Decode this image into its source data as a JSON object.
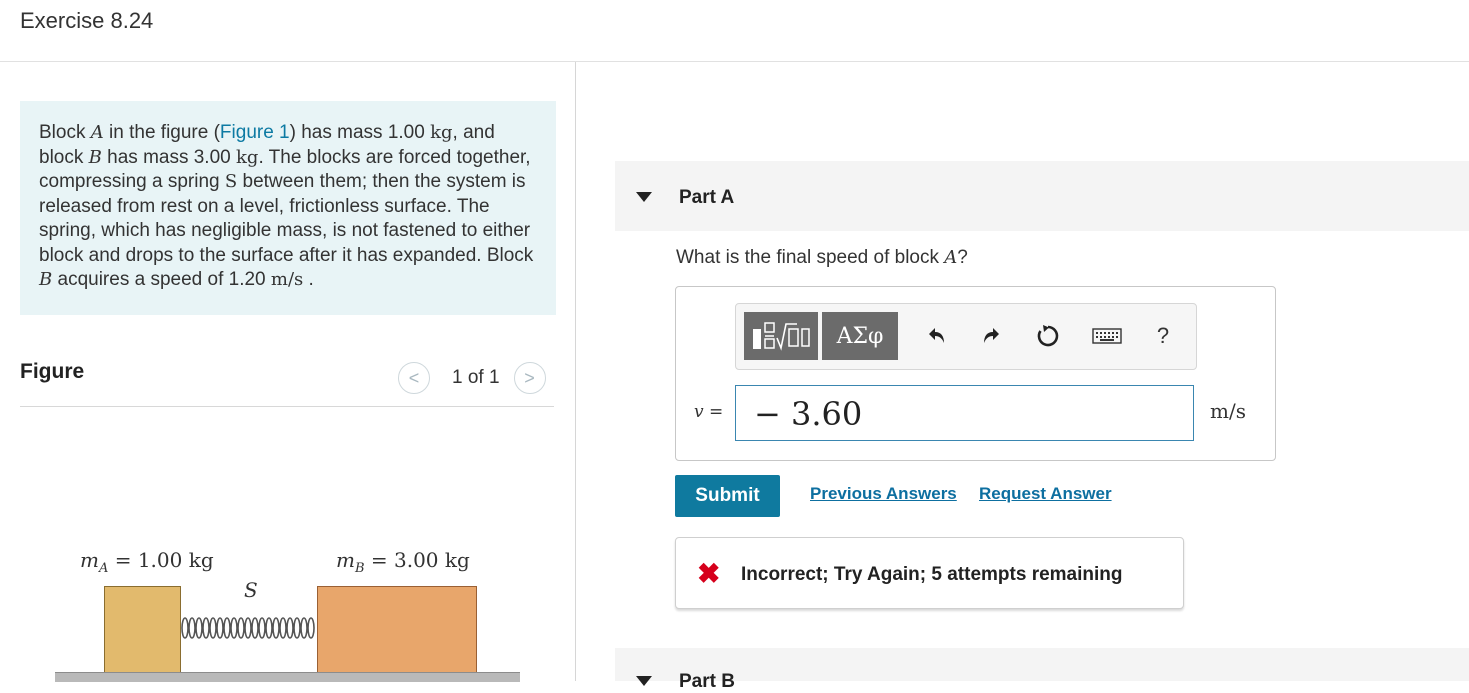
{
  "header": {
    "title": "Exercise 8.24"
  },
  "problem": {
    "seg1": "Block ",
    "blockA": "A",
    "seg2": " in the figure (",
    "figure_link": "Figure 1",
    "seg3": ") has mass 1.00 ",
    "kg1": "kg",
    "seg4": ", and block ",
    "blockB": "B",
    "seg5": " has mass 3.00 ",
    "kg2": "kg",
    "seg6": ". The blocks are forced together, compressing a spring ",
    "springS": "S",
    "seg7": " between them; then the system is released from rest on a level, frictionless surface. The spring, which has negligible mass, is not fastened to either block and drops to the surface after it has expanded. Block ",
    "blockB2": "B",
    "seg8": " acquires a speed of 1.20 ",
    "speed_unit": "m/s",
    "seg9": " ."
  },
  "figure": {
    "label": "Figure",
    "pager": "1 of 1",
    "prev_symbol": "<",
    "next_symbol": ">",
    "mass_a_sym": "m",
    "mass_a_sub": "A",
    "mass_a_val": " = 1.00 kg",
    "mass_b_sym": "m",
    "mass_b_sub": "B",
    "mass_b_val": " = 3.00 kg",
    "spring_label": "S"
  },
  "partA": {
    "label": "Part A",
    "question_pre": "What is the final speed of block ",
    "question_var": "A",
    "question_post": "?",
    "toolbar": {
      "templates_icon": "templates-icon",
      "greek": "ΑΣφ",
      "undo_icon": "undo-icon",
      "redo_icon": "redo-icon",
      "reset_icon": "reset-icon",
      "keyboard_icon": "keyboard-icon",
      "help": "?"
    },
    "var_label": "v",
    "eq": " =",
    "answer_value": "− 3.60",
    "unit": "m/s",
    "submit": "Submit",
    "previous_answers": "Previous Answers",
    "request_answer": "Request Answer",
    "feedback_icon": "✖",
    "feedback": "Incorrect; Try Again; 5 attempts remaining"
  },
  "partB": {
    "label": "Part B"
  }
}
